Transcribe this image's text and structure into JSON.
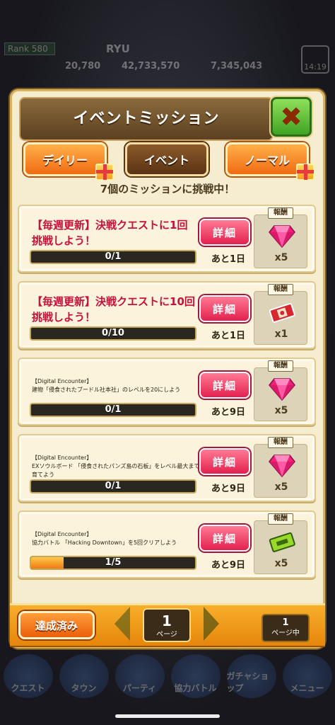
{
  "hud": {
    "rank_label": "Rank 580",
    "username": "RYU",
    "stats": [
      "20,780",
      "42,733,570",
      "7,345,043"
    ],
    "time": "14:19"
  },
  "panel": {
    "title": "イベントミッション",
    "close_label": "✖",
    "tabs": [
      {
        "label": "デイリー",
        "active": false,
        "gift": true
      },
      {
        "label": "イベント",
        "active": true,
        "gift": false
      },
      {
        "label": "ノーマル",
        "active": false,
        "gift": true
      }
    ],
    "challenge_text": "7個のミッションに挑戦中！",
    "reward_label": "報酬",
    "detail_label": "詳細"
  },
  "missions": [
    {
      "title": "【毎週更新】決戦クエストに1回挑戦しよう！",
      "style": "large",
      "progress_text": "0/1",
      "progress": 0,
      "remaining": "あと1日",
      "reward_icon": "gem-icon",
      "reward_qty": "x5"
    },
    {
      "title": "【毎週更新】決戦クエストに10回挑戦しよう！",
      "style": "large",
      "progress_text": "0/10",
      "progress": 0,
      "remaining": "あと1日",
      "reward_icon": "ticket-icon",
      "reward_qty": "x1"
    },
    {
      "title": "【Digital Encounter】\n建物「侵食されたブードル社本社」のレベルを20にしよう",
      "style": "small",
      "progress_text": "0/1",
      "progress": 0,
      "remaining": "あと9日",
      "reward_icon": "gem-icon",
      "reward_qty": "x5"
    },
    {
      "title": "【Digital Encounter】\nEXソウルボード 「侵食されたパンズ島の石板」をレベル最大まで育てよう",
      "style": "small",
      "progress_text": "0/1",
      "progress": 0,
      "remaining": "あと9日",
      "reward_icon": "gem-icon",
      "reward_qty": "x5"
    },
    {
      "title": "【Digital Encounter】\n協力バトル 「Hacking Downtown」を5回クリアしよう",
      "style": "small",
      "progress_text": "1/5",
      "progress": 0.2,
      "remaining": "あと9日",
      "reward_icon": "green-ticket-icon",
      "reward_qty": "x5"
    }
  ],
  "footer": {
    "done_label": "達成済み",
    "current_page": "1",
    "page_unit": "ページ",
    "total_pages": "1",
    "total_unit": "ページ中"
  },
  "bottom_nav": [
    "クエスト",
    "タウン",
    "パーティ",
    "協力バトル",
    "ガチャショップ",
    "メニュー"
  ],
  "colors": {
    "accent_red": "#c8103a",
    "detail_button": "#e3204f",
    "close_button": "#3fa322",
    "tab_orange": "#f06b12",
    "tab_active": "#5b3414",
    "progress_fill": "#ef7a12"
  }
}
